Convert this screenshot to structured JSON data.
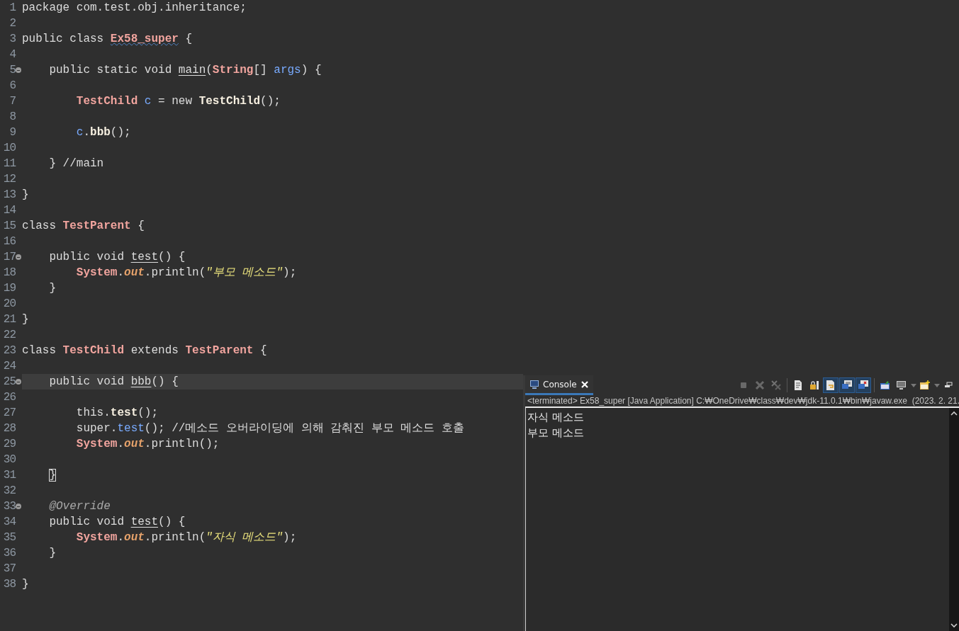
{
  "editor": {
    "lines": [
      {
        "number": "1",
        "tokens": [
          {
            "text": "package com.test.obj.inheritance;",
            "kind": "text"
          }
        ]
      },
      {
        "number": "2"
      },
      {
        "number": "3",
        "tokens": [
          {
            "text": "public class ",
            "kind": "text"
          },
          {
            "text": "Ex58_super",
            "kind": "type-warning"
          },
          {
            "text": " {",
            "kind": "text"
          }
        ],
        "children": [
          {
            "number": "4"
          },
          {
            "number": "5",
            "folded": false,
            "tokens": [
              {
                "text": "public static void ",
                "kind": "text"
              },
              {
                "text": "main",
                "kind": "decl"
              },
              {
                "text": "(",
                "kind": "text"
              },
              {
                "text": "String",
                "kind": "type"
              },
              {
                "text": "[] ",
                "kind": "text"
              },
              {
                "text": "args",
                "kind": "variable"
              },
              {
                "text": ") {",
                "kind": "text"
              }
            ],
            "children": [
              {
                "number": "6"
              },
              {
                "number": "7",
                "tokens": [
                  {
                    "text": "TestChild",
                    "kind": "type"
                  },
                  {
                    "text": " c",
                    "kind": "variable"
                  },
                  {
                    "text": " = new ",
                    "kind": "text"
                  },
                  {
                    "text": "TestChild",
                    "kind": "method"
                  },
                  {
                    "text": "();",
                    "kind": "text"
                  }
                ]
              },
              {
                "number": "8"
              },
              {
                "number": "9",
                "tokens": [
                  {
                    "text": "c",
                    "kind": "variable"
                  },
                  {
                    "text": ".",
                    "kind": "text"
                  },
                  {
                    "text": "bbb",
                    "kind": "method"
                  },
                  {
                    "text": "();",
                    "kind": "text"
                  }
                ]
              },
              {
                "number": "10"
              }
            ]
          },
          {
            "number": "11",
            "tokens": [
              {
                "text": "} ",
                "kind": "text"
              },
              {
                "text": "//main",
                "kind": "comment"
              }
            ]
          },
          {
            "number": "12"
          }
        ]
      },
      {
        "number": "13",
        "tokens": [
          {
            "text": "}",
            "kind": "text"
          }
        ]
      },
      {
        "number": "14"
      },
      {
        "number": "15",
        "tokens": [
          {
            "text": "class ",
            "kind": "text"
          },
          {
            "text": "TestParent",
            "kind": "type"
          },
          {
            "text": " {",
            "kind": "text"
          }
        ],
        "children": [
          {
            "number": "16"
          },
          {
            "number": "17",
            "folded": false,
            "tokens": [
              {
                "text": "public void ",
                "kind": "text"
              },
              {
                "text": "test",
                "kind": "decl"
              },
              {
                "text": "() {",
                "kind": "text"
              }
            ],
            "children": [
              {
                "number": "18",
                "tokens": [
                  {
                    "text": "System",
                    "kind": "type"
                  },
                  {
                    "text": ".",
                    "kind": "text"
                  },
                  {
                    "text": "out",
                    "kind": "field"
                  },
                  {
                    "text": ".println(",
                    "kind": "text"
                  },
                  {
                    "text": "\"부모 메소드\"",
                    "kind": "string"
                  },
                  {
                    "text": ");",
                    "kind": "text"
                  }
                ]
              }
            ]
          },
          {
            "number": "19",
            "tokens": [
              {
                "text": "}",
                "kind": "text"
              }
            ]
          },
          {
            "number": "20"
          }
        ]
      },
      {
        "number": "21",
        "tokens": [
          {
            "text": "}",
            "kind": "text"
          }
        ]
      },
      {
        "number": "22"
      },
      {
        "number": "23",
        "tokens": [
          {
            "text": "class ",
            "kind": "text"
          },
          {
            "text": "TestChild",
            "kind": "type"
          },
          {
            "text": " extends ",
            "kind": "text"
          },
          {
            "text": "TestParent",
            "kind": "type"
          },
          {
            "text": " {",
            "kind": "text"
          }
        ],
        "children": [
          {
            "number": "24"
          },
          {
            "number": "25",
            "folded": false,
            "current": true,
            "tokens": [
              {
                "text": "public void ",
                "kind": "text"
              },
              {
                "text": "bbb",
                "kind": "decl"
              },
              {
                "text": "() {",
                "kind": "text"
              }
            ],
            "children": [
              {
                "number": "26"
              },
              {
                "number": "27",
                "tokens": [
                  {
                    "text": "this.",
                    "kind": "text"
                  },
                  {
                    "text": "test",
                    "kind": "method"
                  },
                  {
                    "text": "();",
                    "kind": "text"
                  }
                ]
              },
              {
                "number": "28",
                "tokens": [
                  {
                    "text": "super.",
                    "kind": "text"
                  },
                  {
                    "text": "test",
                    "kind": "variable"
                  },
                  {
                    "text": "(); ",
                    "kind": "text"
                  },
                  {
                    "text": "//메소드 오버라이딩에 의해 감춰진 부모 메소드 호출",
                    "kind": "comment"
                  }
                ]
              },
              {
                "number": "29",
                "tokens": [
                  {
                    "text": "System",
                    "kind": "type"
                  },
                  {
                    "text": ".",
                    "kind": "text"
                  },
                  {
                    "text": "out",
                    "kind": "field"
                  },
                  {
                    "text": ".println();",
                    "kind": "text"
                  }
                ]
              },
              {
                "number": "30"
              }
            ]
          },
          {
            "number": "31",
            "tokens": [
              {
                "text": "}",
                "kind": "bracket-match"
              }
            ]
          },
          {
            "number": "32"
          },
          {
            "number": "33",
            "folded": false,
            "tokens": [
              {
                "text": "@Override",
                "kind": "annotation"
              }
            ]
          },
          {
            "number": "34",
            "tokens": [
              {
                "text": "public void ",
                "kind": "text"
              },
              {
                "text": "test",
                "kind": "decl"
              },
              {
                "text": "() {",
                "kind": "text"
              }
            ],
            "children": [
              {
                "number": "35",
                "tokens": [
                  {
                    "text": "System",
                    "kind": "type"
                  },
                  {
                    "text": ".",
                    "kind": "text"
                  },
                  {
                    "text": "out",
                    "kind": "field"
                  },
                  {
                    "text": ".println(",
                    "kind": "text"
                  },
                  {
                    "text": "\"자식 메소드\"",
                    "kind": "string"
                  },
                  {
                    "text": ");",
                    "kind": "text"
                  }
                ]
              }
            ]
          },
          {
            "number": "36",
            "tokens": [
              {
                "text": "}",
                "kind": "text"
              }
            ]
          },
          {
            "number": "37"
          }
        ]
      },
      {
        "number": "38",
        "tokens": [
          {
            "text": "}",
            "kind": "text"
          }
        ]
      }
    ]
  },
  "console": {
    "tab": {
      "label": "Console",
      "selected": true
    },
    "toolbar": [
      {
        "kind": "terminate",
        "disabled": true
      },
      {
        "kind": "remove",
        "disabled": true
      },
      {
        "kind": "remove-all",
        "disabled": true
      },
      {
        "kind": "separator"
      },
      {
        "kind": "clear",
        "disabled": false
      },
      {
        "kind": "scroll-lock",
        "disabled": false
      },
      {
        "kind": "word-wrap",
        "pressed": true
      },
      {
        "kind": "show-stdout",
        "pressed": true
      },
      {
        "kind": "show-stderr",
        "pressed": true
      },
      {
        "kind": "separator"
      },
      {
        "kind": "pin",
        "disabled": false
      },
      {
        "kind": "display-console",
        "disabled": false
      },
      {
        "kind": "dropdown"
      },
      {
        "kind": "open-console",
        "disabled": false
      },
      {
        "kind": "dropdown"
      },
      {
        "kind": "minimize",
        "disabled": false
      }
    ],
    "process": "<terminated> Ex58_super [Java Application] C:₩OneDrive₩class₩dev₩jdk-11.0.1₩bin₩javaw.exe  (2023. 2. 21.",
    "output": [
      "자식 메소드",
      "부모 메소드"
    ]
  }
}
